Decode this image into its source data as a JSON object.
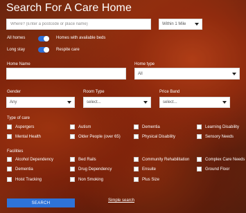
{
  "page_title": "Search For A Care Home",
  "search": {
    "placeholder": "Where? (Enter a postcode or place name)",
    "value": ""
  },
  "distance": {
    "selected": "Within 1 Mile"
  },
  "toggles": [
    {
      "label": "All homes",
      "on": true,
      "option_label": "Homes with available beds"
    },
    {
      "label": "Long stay",
      "on": true,
      "option_label": "Respite care"
    }
  ],
  "home_name": {
    "label": "Home Name",
    "value": ""
  },
  "home_type": {
    "label": "Home type",
    "selected": "All"
  },
  "gender": {
    "label": "Gender",
    "selected": "Any"
  },
  "room_type": {
    "label": "Room Type",
    "selected": "select..."
  },
  "price_band": {
    "label": "Price Band",
    "selected": "select..."
  },
  "type_of_care": {
    "heading": "Type of care",
    "items": [
      "Aspergers",
      "Autism",
      "Dementia",
      "Learning Disability",
      "Mental Health",
      "Older People (over 65)",
      "Physical Disability",
      "Sensory Needs"
    ]
  },
  "facilities": {
    "heading": "Facilities",
    "items": [
      "Alcohol Dependency",
      "Bed Rails",
      "Community Rehabilitation",
      "Complex Care Needs",
      "Dementia",
      "Drug Dependency",
      "Ensuite",
      "Ground Floor",
      "Hoist Tracking",
      "Non Smoking",
      "Plus Size"
    ]
  },
  "actions": {
    "search_label": "SEARCH",
    "simple_search_label": "Simple search"
  }
}
